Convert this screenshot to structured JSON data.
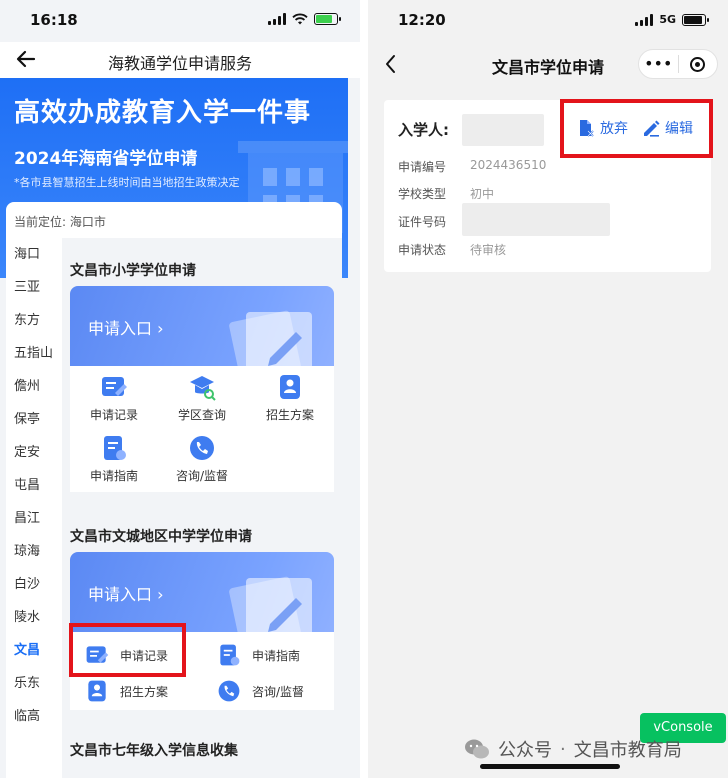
{
  "left_screen": {
    "status": {
      "time": "16:18",
      "battery_color": "#3ccf4e"
    },
    "nav": {
      "title": "海教通学位申请服务",
      "back_icon": "arrow-left"
    },
    "banner": {
      "headline": "高效办成教育入学一件事",
      "subtitle": "2024年海南省学位申请",
      "note": "*各市县智慧招生上线时间由当地招生政策决定"
    },
    "location": {
      "label": "当前定位:",
      "city": "海口市"
    },
    "cities": [
      "海口",
      "三亚",
      "东方",
      "五指山",
      "儋州",
      "保亭",
      "定安",
      "屯昌",
      "昌江",
      "琼海",
      "白沙",
      "陵水",
      "文昌",
      "乐东",
      "临高"
    ],
    "active_city": "文昌",
    "sections": [
      {
        "title": "文昌市小学学位申请",
        "entry_label": "申请入口",
        "items": [
          {
            "label": "申请记录",
            "icon": "record-icon"
          },
          {
            "label": "学区查询",
            "icon": "school-district-icon"
          },
          {
            "label": "招生方案",
            "icon": "enrollment-plan-icon"
          },
          {
            "label": "申请指南",
            "icon": "guide-icon"
          },
          {
            "label": "咨询/监督",
            "icon": "phone-consult-icon"
          }
        ]
      },
      {
        "title": "文昌市文城地区中学学位申请",
        "entry_label": "申请入口",
        "items": [
          {
            "label": "申请记录",
            "icon": "record-icon"
          },
          {
            "label": "申请指南",
            "icon": "guide-icon"
          },
          {
            "label": "招生方案",
            "icon": "enrollment-plan-icon"
          },
          {
            "label": "咨询/监督",
            "icon": "phone-consult-icon"
          }
        ]
      },
      {
        "title": "文昌市七年级入学信息收集"
      }
    ],
    "highlight_color": "#e3141b"
  },
  "right_screen": {
    "status": {
      "time": "12:20",
      "network": "5G"
    },
    "nav": {
      "title": "文昌市学位申请",
      "more_icon": "•••"
    },
    "record": {
      "student_label": "入学人:",
      "fields": [
        {
          "label": "申请编号",
          "value": "2024436510"
        },
        {
          "label": "学校类型",
          "value": "初中"
        },
        {
          "label": "证件号码",
          "value": ""
        },
        {
          "label": "申请状态",
          "value": "待审核"
        }
      ],
      "actions": [
        {
          "label": "放弃",
          "icon": "abandon-icon"
        },
        {
          "label": "编辑",
          "icon": "edit-icon"
        }
      ]
    },
    "vconsole_label": "vConsole",
    "watermark": {
      "prefix": "公众号",
      "separator": "·",
      "name": "文昌市教育局"
    }
  }
}
